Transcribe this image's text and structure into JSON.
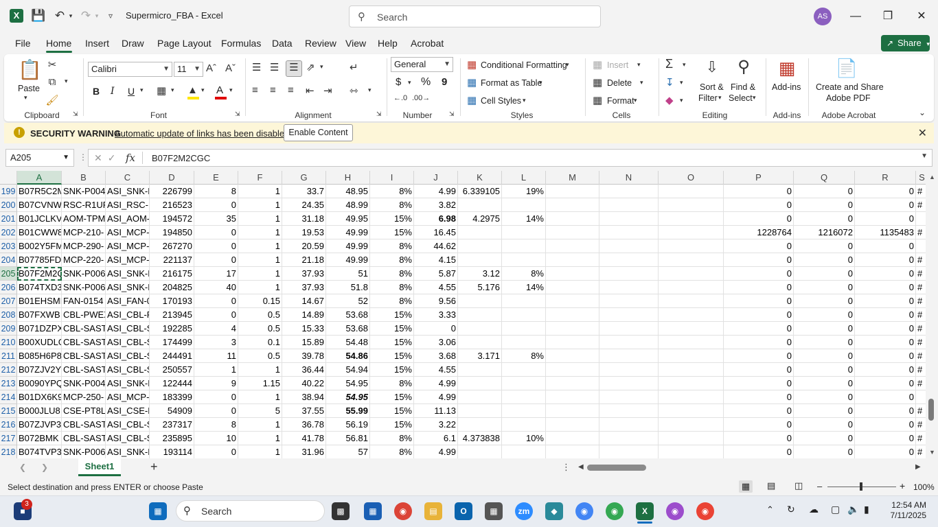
{
  "titlebar": {
    "app_logo": "X",
    "title": "Supermicro_FBA  -  Excel",
    "search_placeholder": "Search",
    "avatar": "AS"
  },
  "menu": {
    "tabs": [
      "File",
      "Home",
      "Insert",
      "Draw",
      "Page Layout",
      "Formulas",
      "Data",
      "Review",
      "View",
      "Help",
      "Acrobat"
    ],
    "active": "Home",
    "share_label": "Share"
  },
  "ribbon": {
    "clipboard": {
      "paste": "Paste",
      "label": "Clipboard"
    },
    "font": {
      "name": "Calibri",
      "size": "11",
      "bold": "B",
      "italic": "I",
      "underline": "U",
      "label": "Font"
    },
    "alignment": {
      "label": "Alignment"
    },
    "number": {
      "format": "General",
      "currency": "$",
      "percent": "%",
      "comma": "9",
      "label": "Number"
    },
    "styles": {
      "conditional": "Conditional Formatting",
      "table": "Format as Table",
      "cell_styles": "Cell Styles",
      "label": "Styles"
    },
    "cells": {
      "insert": "Insert",
      "delete": "Delete",
      "format": "Format",
      "label": "Cells"
    },
    "editing": {
      "sort_line1": "Sort &",
      "sort_line2": "Filter",
      "find_line1": "Find &",
      "find_line2": "Select",
      "label": "Editing"
    },
    "addins": {
      "button": "Add-ins",
      "label": "Add-ins"
    },
    "acrobat": {
      "line1": "Create and Share",
      "line2": "Adobe PDF",
      "label": "Adobe Acrobat"
    }
  },
  "security": {
    "title": "SECURITY WARNING",
    "message": "Automatic update of links has been disabled",
    "button": "Enable Content"
  },
  "formula_bar": {
    "name_box": "A205",
    "fx": "fx",
    "value": "B07F2M2CGC"
  },
  "grid": {
    "columns": [
      "A",
      "B",
      "C",
      "D",
      "E",
      "F",
      "G",
      "H",
      "I",
      "J",
      "K",
      "L",
      "M",
      "N",
      "O",
      "P",
      "Q",
      "R",
      "S"
    ],
    "rows": [
      {
        "n": "199",
        "A": "B07R5C2M",
        "B": "SNK-P004",
        "C": "ASI_SNK-P",
        "D": "226799",
        "E": "8",
        "F": "1",
        "G": "33.7",
        "H": "48.95",
        "I": "8%",
        "J": "4.99",
        "K": "6.339105",
        "L": "19%",
        "P": "0",
        "Q": "0",
        "R": "0",
        "S": "#"
      },
      {
        "n": "200",
        "A": "B07CVNW",
        "B": "RSC-R1UF",
        "C": "ASI_RSC-R",
        "D": "216523",
        "E": "0",
        "F": "1",
        "G": "24.35",
        "H": "48.99",
        "I": "8%",
        "J": "3.82",
        "K": "",
        "L": "",
        "P": "0",
        "Q": "0",
        "R": "0",
        "S": "#"
      },
      {
        "n": "201",
        "A": "B01JCLKV",
        "B": "AOM-TPM",
        "C": "ASI_AOM-",
        "D": "194572",
        "E": "35",
        "F": "1",
        "G": "31.18",
        "H": "49.95",
        "I": "15%",
        "J": "6.98",
        "K": "4.2975",
        "L": "14%",
        "P": "0",
        "Q": "0",
        "R": "0",
        "S": ""
      },
      {
        "n": "202",
        "A": "B01CWW8",
        "B": "MCP-210-",
        "C": "ASI_MCP-",
        "D": "194850",
        "E": "0",
        "F": "1",
        "G": "19.53",
        "H": "49.99",
        "I": "15%",
        "J": "16.45",
        "K": "",
        "L": "",
        "P": "1228764",
        "Q": "1216072",
        "R": "1135483",
        "S": "#"
      },
      {
        "n": "203",
        "A": "B002Y5FM",
        "B": "MCP-290-",
        "C": "ASI_MCP-",
        "D": "267270",
        "E": "0",
        "F": "1",
        "G": "20.59",
        "H": "49.99",
        "I": "8%",
        "J": "44.62",
        "K": "",
        "L": "",
        "P": "0",
        "Q": "0",
        "R": "0",
        "S": ""
      },
      {
        "n": "204",
        "A": "B07785FD",
        "B": "MCP-220-",
        "C": "ASI_MCP-",
        "D": "221137",
        "E": "0",
        "F": "1",
        "G": "21.18",
        "H": "49.99",
        "I": "8%",
        "J": "4.15",
        "K": "",
        "L": "",
        "P": "0",
        "Q": "0",
        "R": "0",
        "S": "#"
      },
      {
        "n": "205",
        "A": "B07F2M2C",
        "B": "SNK-P006",
        "C": "ASI_SNK-P",
        "D": "216175",
        "E": "17",
        "F": "1",
        "G": "37.93",
        "H": "51",
        "I": "8%",
        "J": "5.87",
        "K": "3.12",
        "L": "8%",
        "P": "0",
        "Q": "0",
        "R": "0",
        "S": "#"
      },
      {
        "n": "206",
        "A": "B074TXD3",
        "B": "SNK-P006",
        "C": "ASI_SNK-P",
        "D": "204825",
        "E": "40",
        "F": "1",
        "G": "37.93",
        "H": "51.8",
        "I": "8%",
        "J": "4.55",
        "K": "5.176",
        "L": "14%",
        "P": "0",
        "Q": "0",
        "R": "0",
        "S": "#"
      },
      {
        "n": "207",
        "A": "B01EHSMH",
        "B": "FAN-0154",
        "C": "ASI_FAN-0",
        "D": "170193",
        "E": "0",
        "F": "0.15",
        "G": "14.67",
        "H": "52",
        "I": "8%",
        "J": "9.56",
        "K": "",
        "L": "",
        "P": "0",
        "Q": "0",
        "R": "0",
        "S": "#"
      },
      {
        "n": "208",
        "A": "B07FXWB",
        "B": "CBL-PWEX",
        "C": "ASI_CBL-P",
        "D": "213945",
        "E": "0",
        "F": "0.5",
        "G": "14.89",
        "H": "53.68",
        "I": "15%",
        "J": "3.33",
        "K": "",
        "L": "",
        "P": "0",
        "Q": "0",
        "R": "0",
        "S": "#"
      },
      {
        "n": "209",
        "A": "B071DZPX",
        "B": "CBL-SAST-",
        "C": "ASI_CBL-S",
        "D": "192285",
        "E": "4",
        "F": "0.5",
        "G": "15.33",
        "H": "53.68",
        "I": "15%",
        "J": "0",
        "K": "",
        "L": "",
        "P": "0",
        "Q": "0",
        "R": "0",
        "S": "#"
      },
      {
        "n": "210",
        "A": "B00XUDLG",
        "B": "CBL-SAST-",
        "C": "ASI_CBL-S",
        "D": "174499",
        "E": "3",
        "F": "0.1",
        "G": "15.89",
        "H": "54.48",
        "I": "15%",
        "J": "3.06",
        "K": "",
        "L": "",
        "P": "0",
        "Q": "0",
        "R": "0",
        "S": "#"
      },
      {
        "n": "211",
        "A": "B085H6P8",
        "B": "CBL-SAST-",
        "C": "ASI_CBL-S",
        "D": "244491",
        "E": "11",
        "F": "0.5",
        "G": "39.78",
        "H": "54.86",
        "I": "15%",
        "J": "3.68",
        "K": "3.171",
        "L": "8%",
        "P": "0",
        "Q": "0",
        "R": "0",
        "S": "#"
      },
      {
        "n": "212",
        "A": "B07ZJV2Y",
        "B": "CBL-SAST-",
        "C": "ASI_CBL-S",
        "D": "250557",
        "E": "1",
        "F": "1",
        "G": "36.44",
        "H": "54.94",
        "I": "15%",
        "J": "4.55",
        "K": "",
        "L": "",
        "P": "0",
        "Q": "0",
        "R": "0",
        "S": "#"
      },
      {
        "n": "213",
        "A": "B0090YPQ",
        "B": "SNK-P004",
        "C": "ASI_SNK-P",
        "D": "122444",
        "E": "9",
        "F": "1.15",
        "G": "40.22",
        "H": "54.95",
        "I": "8%",
        "J": "4.99",
        "K": "",
        "L": "",
        "P": "0",
        "Q": "0",
        "R": "0",
        "S": "#"
      },
      {
        "n": "214",
        "A": "B01DX6K9",
        "B": "MCP-250-",
        "C": "ASI_MCP-",
        "D": "183399",
        "E": "0",
        "F": "1",
        "G": "38.94",
        "H": "54.95",
        "I": "15%",
        "J": "4.99",
        "K": "",
        "L": "",
        "P": "0",
        "Q": "0",
        "R": "0",
        "S": ""
      },
      {
        "n": "215",
        "A": "B000JLU8",
        "B": "CSE-PT8L",
        "C": "ASI_CSE-P",
        "D": "54909",
        "E": "0",
        "F": "5",
        "G": "37.55",
        "H": "55.99",
        "I": "15%",
        "J": "11.13",
        "K": "",
        "L": "",
        "P": "0",
        "Q": "0",
        "R": "0",
        "S": "#"
      },
      {
        "n": "216",
        "A": "B07ZJVP3",
        "B": "CBL-SAST-",
        "C": "ASI_CBL-S",
        "D": "237317",
        "E": "8",
        "F": "1",
        "G": "36.78",
        "H": "56.19",
        "I": "15%",
        "J": "3.22",
        "K": "",
        "L": "",
        "P": "0",
        "Q": "0",
        "R": "0",
        "S": "#"
      },
      {
        "n": "217",
        "A": "B072BMK",
        "B": "CBL-SAST-",
        "C": "ASI_CBL-S",
        "D": "235895",
        "E": "10",
        "F": "1",
        "G": "41.78",
        "H": "56.81",
        "I": "8%",
        "J": "6.1",
        "K": "4.373838",
        "L": "10%",
        "P": "0",
        "Q": "0",
        "R": "0",
        "S": "#"
      },
      {
        "n": "218",
        "A": "B074TVP3",
        "B": "SNK-P006",
        "C": "ASI_SNK-P",
        "D": "193114",
        "E": "0",
        "F": "1",
        "G": "31.96",
        "H": "57",
        "I": "8%",
        "J": "4.99",
        "K": "",
        "L": "",
        "P": "0",
        "Q": "0",
        "R": "0",
        "S": "#"
      }
    ]
  },
  "sheet": {
    "tab": "Sheet1",
    "add": "+"
  },
  "status": {
    "message": "Select destination and press ENTER or choose Paste",
    "zoom": "100%"
  },
  "taskbar": {
    "search": "Search",
    "time": "12:54 AM",
    "date": "7/11/2025",
    "badge": "3"
  }
}
